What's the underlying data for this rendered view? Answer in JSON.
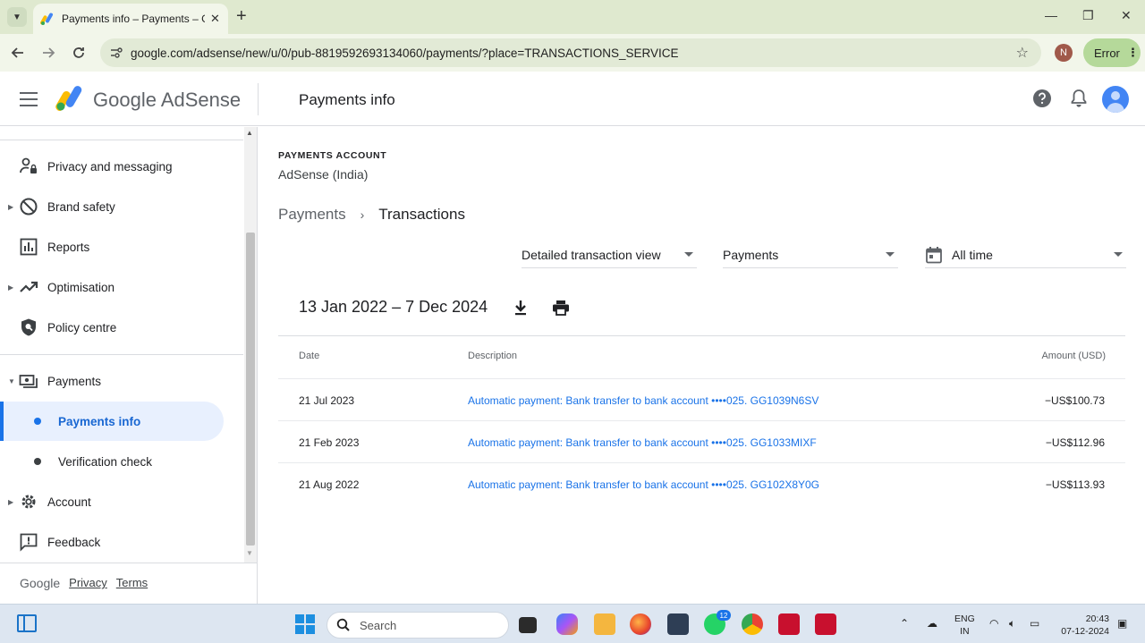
{
  "browser": {
    "tab_title": "Payments info – Payments – Go",
    "url": "google.com/adsense/new/u/0/pub-8819592693134060/payments/?place=TRANSACTIONS_SERVICE",
    "profile_initial": "N",
    "error_label": "Error",
    "new_tab": "+",
    "tab_close": "✕",
    "minimize": "—",
    "restore": "❐",
    "close": "✕"
  },
  "header": {
    "brand": "Google AdSense",
    "page_title": "Payments info"
  },
  "sidebar": {
    "items": [
      {
        "label": "Privacy and messaging",
        "icon": "person-lock-icon"
      },
      {
        "label": "Brand safety",
        "icon": "block-icon",
        "expandable": true
      },
      {
        "label": "Reports",
        "icon": "bar-chart-icon"
      },
      {
        "label": "Optimisation",
        "icon": "trending-up-icon",
        "expandable": true
      },
      {
        "label": "Policy centre",
        "icon": "shield-search-icon"
      }
    ],
    "payments": {
      "label": "Payments",
      "sub_items": [
        {
          "label": "Payments info",
          "active": true
        },
        {
          "label": "Verification check",
          "active": false
        }
      ]
    },
    "bottom_items": [
      {
        "label": "Account",
        "icon": "gear-icon",
        "expandable": true
      },
      {
        "label": "Feedback",
        "icon": "feedback-icon"
      }
    ],
    "footer": {
      "google": "Google",
      "privacy": "Privacy",
      "terms": "Terms"
    }
  },
  "main": {
    "account_label": "PAYMENTS ACCOUNT",
    "account_name": "AdSense (India)",
    "breadcrumb": {
      "parent": "Payments",
      "separator": "›",
      "current": "Transactions"
    },
    "filters": {
      "view": "Detailed transaction view",
      "type": "Payments",
      "period": "All time"
    },
    "date_range": "13 Jan 2022 – 7 Dec 2024",
    "table": {
      "headers": {
        "date": "Date",
        "description": "Description",
        "amount": "Amount (USD)"
      },
      "rows": [
        {
          "date": "21 Jul 2023",
          "description": "Automatic payment: Bank transfer to bank account  ••••025. GG1039N6SV",
          "amount": "−US$100.73"
        },
        {
          "date": "21 Feb 2023",
          "description": "Automatic payment: Bank transfer to bank account  ••••025. GG1033MIXF",
          "amount": "−US$112.96"
        },
        {
          "date": "21 Aug 2022",
          "description": "Automatic payment: Bank transfer to bank account  ••••025. GG102X8Y0G",
          "amount": "−US$113.93"
        }
      ]
    }
  },
  "taskbar": {
    "search_placeholder": "Search",
    "whatsapp_badge": "12",
    "lang_line1": "ENG",
    "lang_line2": "IN",
    "time": "20:43",
    "date": "07-12-2024"
  }
}
